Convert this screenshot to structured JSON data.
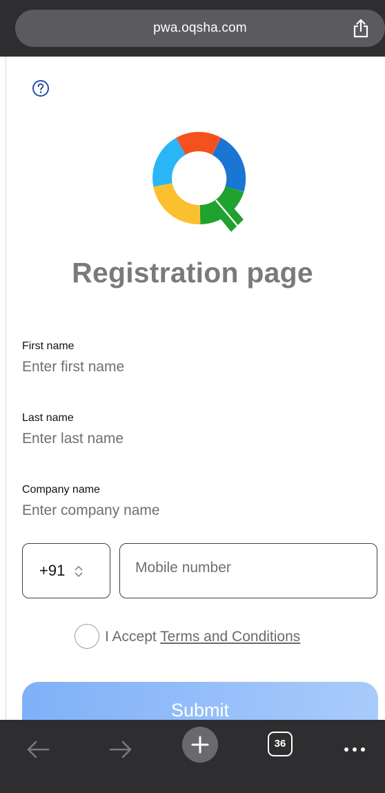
{
  "browser": {
    "url": "pwa.oqsha.com",
    "tab_count": "36",
    "icons": {
      "share": "share-icon",
      "back": "back-arrow-icon",
      "forward": "forward-arrow-icon",
      "new_tab": "plus-icon",
      "more": "more-dots-icon"
    }
  },
  "page": {
    "title": "Registration page",
    "help_icon": "question-circle-icon",
    "logo": "oqsha-logo"
  },
  "form": {
    "first_name": {
      "label": "First name",
      "placeholder": "Enter first name"
    },
    "last_name": {
      "label": "Last name",
      "placeholder": "Enter last name"
    },
    "company_name": {
      "label": "Company name",
      "placeholder": "Enter company name"
    },
    "country_code": "+91",
    "mobile_placeholder": "Mobile number",
    "accept_prefix": "I Accept ",
    "terms_link": "Terms and Conditions",
    "submit_label": "Submit"
  },
  "colors": {
    "title": "#7a7a7a",
    "submit_start": "#7fb0f8",
    "submit_end": "#a9cbfb",
    "browser_chrome": "#2e2e30"
  }
}
